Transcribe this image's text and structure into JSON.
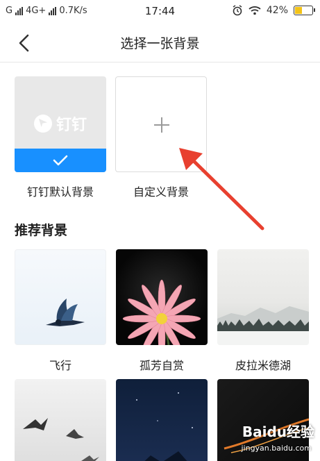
{
  "status_bar": {
    "carrier_left": "G",
    "network": "4G+",
    "speed": "0.7K/s",
    "time": "17:44",
    "battery_percent": "42%",
    "battery_level": 0.42,
    "battery_color": "#f3c318"
  },
  "nav": {
    "title": "选择一张背景",
    "back_icon": "chevron-left-icon"
  },
  "top_options": [
    {
      "label": "钉钉默认背景",
      "logo_text": "钉钉",
      "selected": true
    },
    {
      "label": "自定义背景",
      "icon": "plus-icon"
    }
  ],
  "section": {
    "title": "推荐背景"
  },
  "recommended": [
    {
      "label": "飞行"
    },
    {
      "label": "孤芳自赏"
    },
    {
      "label": "皮拉米德湖"
    },
    {
      "label": ""
    },
    {
      "label": ""
    },
    {
      "label": ""
    }
  ],
  "watermark": {
    "text": "Baidu经验",
    "url": "jingyan.baidu.com"
  },
  "colors": {
    "accent": "#1890ff",
    "annotation_arrow": "#e8402f"
  }
}
